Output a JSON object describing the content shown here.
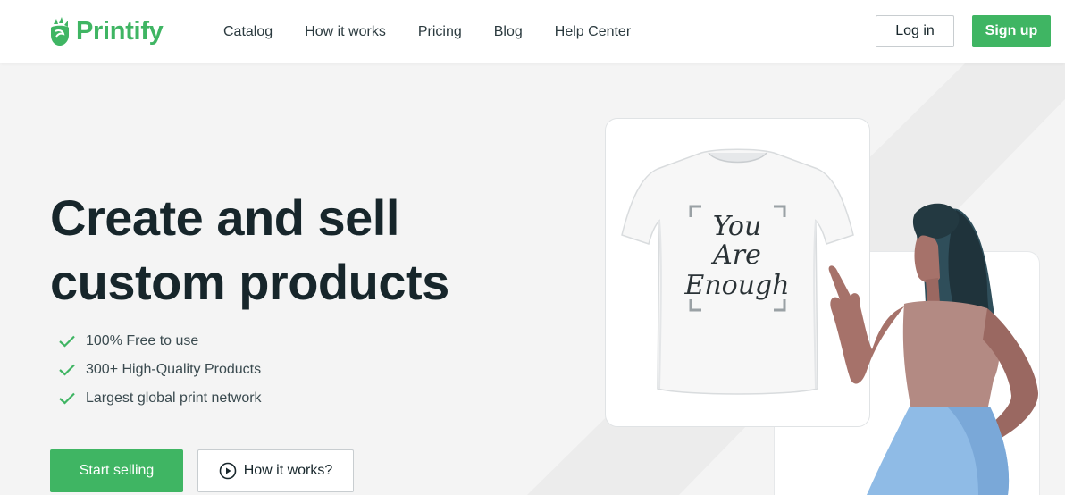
{
  "header": {
    "brand": "Printify",
    "nav": [
      "Catalog",
      "How it works",
      "Pricing",
      "Blog",
      "Help Center"
    ],
    "login_label": "Log in",
    "signup_label": "Sign up"
  },
  "hero": {
    "title_line1": "Create and sell",
    "title_line2": "custom products",
    "features": [
      "100% Free to use",
      "300+ High-Quality Products",
      "Largest global print network"
    ],
    "start_label": "Start selling",
    "how_label": "How it works?"
  },
  "mockup": {
    "shirt_text": [
      "You",
      "Are",
      "Enough"
    ]
  },
  "colors": {
    "brand_green": "#3fb563",
    "dark_text": "#17262b"
  }
}
